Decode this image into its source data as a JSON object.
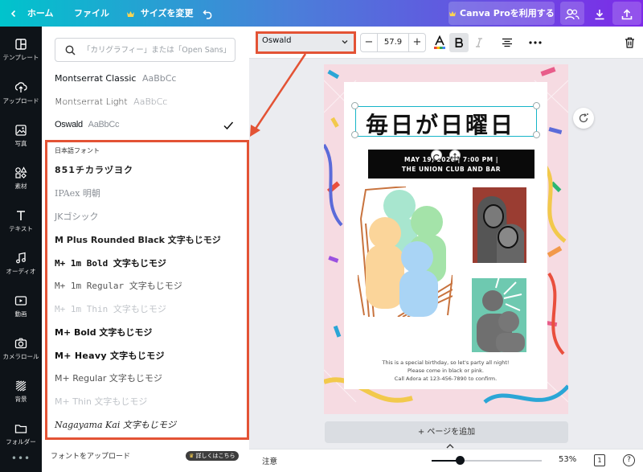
{
  "topbar": {
    "home": "ホーム",
    "file": "ファイル",
    "resize": "サイズを変更",
    "pro_button": "Canva Proを利用する"
  },
  "rail": [
    {
      "label": "テンプレート",
      "icon": "template-icon"
    },
    {
      "label": "アップロード",
      "icon": "upload-icon"
    },
    {
      "label": "写真",
      "icon": "photo-icon"
    },
    {
      "label": "素材",
      "icon": "elements-icon"
    },
    {
      "label": "テキスト",
      "icon": "text-icon"
    },
    {
      "label": "オーディオ",
      "icon": "audio-icon"
    },
    {
      "label": "動画",
      "icon": "video-icon"
    },
    {
      "label": "カメラロール",
      "icon": "camera-icon"
    },
    {
      "label": "背景",
      "icon": "background-icon"
    },
    {
      "label": "フォルダー",
      "icon": "folder-icon"
    }
  ],
  "panel": {
    "search_placeholder": "「カリグラフィー」または「Open Sans」",
    "latin_fonts": [
      {
        "name": "Montserrat Classic",
        "sample": "AaBbCc"
      },
      {
        "name": "Montserrat Light",
        "sample": "AaBbCc"
      },
      {
        "name": "Oswald",
        "sample": "AaBbCc"
      }
    ],
    "section_title": "日本語フォント",
    "jp_fonts": [
      {
        "name": "851チカラヅヨク",
        "color": "#222222"
      },
      {
        "name": "IPAex 明朝",
        "color": "#8a8f96"
      },
      {
        "name": "JKゴシック",
        "color": "#8a8f96"
      },
      {
        "name": "M Plus Rounded Black  文字もじモジ",
        "color": "#111111"
      },
      {
        "name": "M+ 1m Bold  文字もじモジ",
        "color": "#111111"
      },
      {
        "name": "M+ 1m Regular  文字もじモジ",
        "color": "#555555"
      },
      {
        "name": "M+ 1m Thin  文字もじモジ",
        "color": "#c0c4c9"
      },
      {
        "name": "M+ Bold  文字もじモジ",
        "color": "#111111"
      },
      {
        "name": "M+ Heavy  文字もじモジ",
        "color": "#111111"
      },
      {
        "name": "M+ Regular  文字もじモジ",
        "color": "#555555"
      },
      {
        "name": "M+ Thin  文字もじモジ",
        "color": "#c0c4c9"
      },
      {
        "name": "Nagayama Kai  文字もじモジ",
        "color": "#222222"
      }
    ],
    "upgrade_text": "フォントをアップロード",
    "upgrade_badge": "詳しくはこちら"
  },
  "toolbar": {
    "font_name": "Oswald",
    "font_size": "57.9",
    "minus": "−",
    "plus": "+"
  },
  "design": {
    "title": "毎日が日曜日",
    "banner_line1": "MAY 19, 2020 | 7:00 PM |",
    "banner_line2": "THE UNION CLUB AND BAR",
    "footer_line1": "This is a special birthday, so let's party all night!",
    "footer_line2": "Please come in black or pink.",
    "footer_line3": "Call Adora at 123-456-7890 to confirm."
  },
  "canvas": {
    "add_page": "+ ページを追加"
  },
  "bottombar": {
    "note": "注意",
    "zoom_value": "53%",
    "zoom_fraction": 0.26,
    "page_count": "1",
    "help": "?"
  },
  "colors": {
    "annotation": "#e35335",
    "accent_teal": "#00c4cc",
    "accent_purple": "#7d2ae8"
  }
}
